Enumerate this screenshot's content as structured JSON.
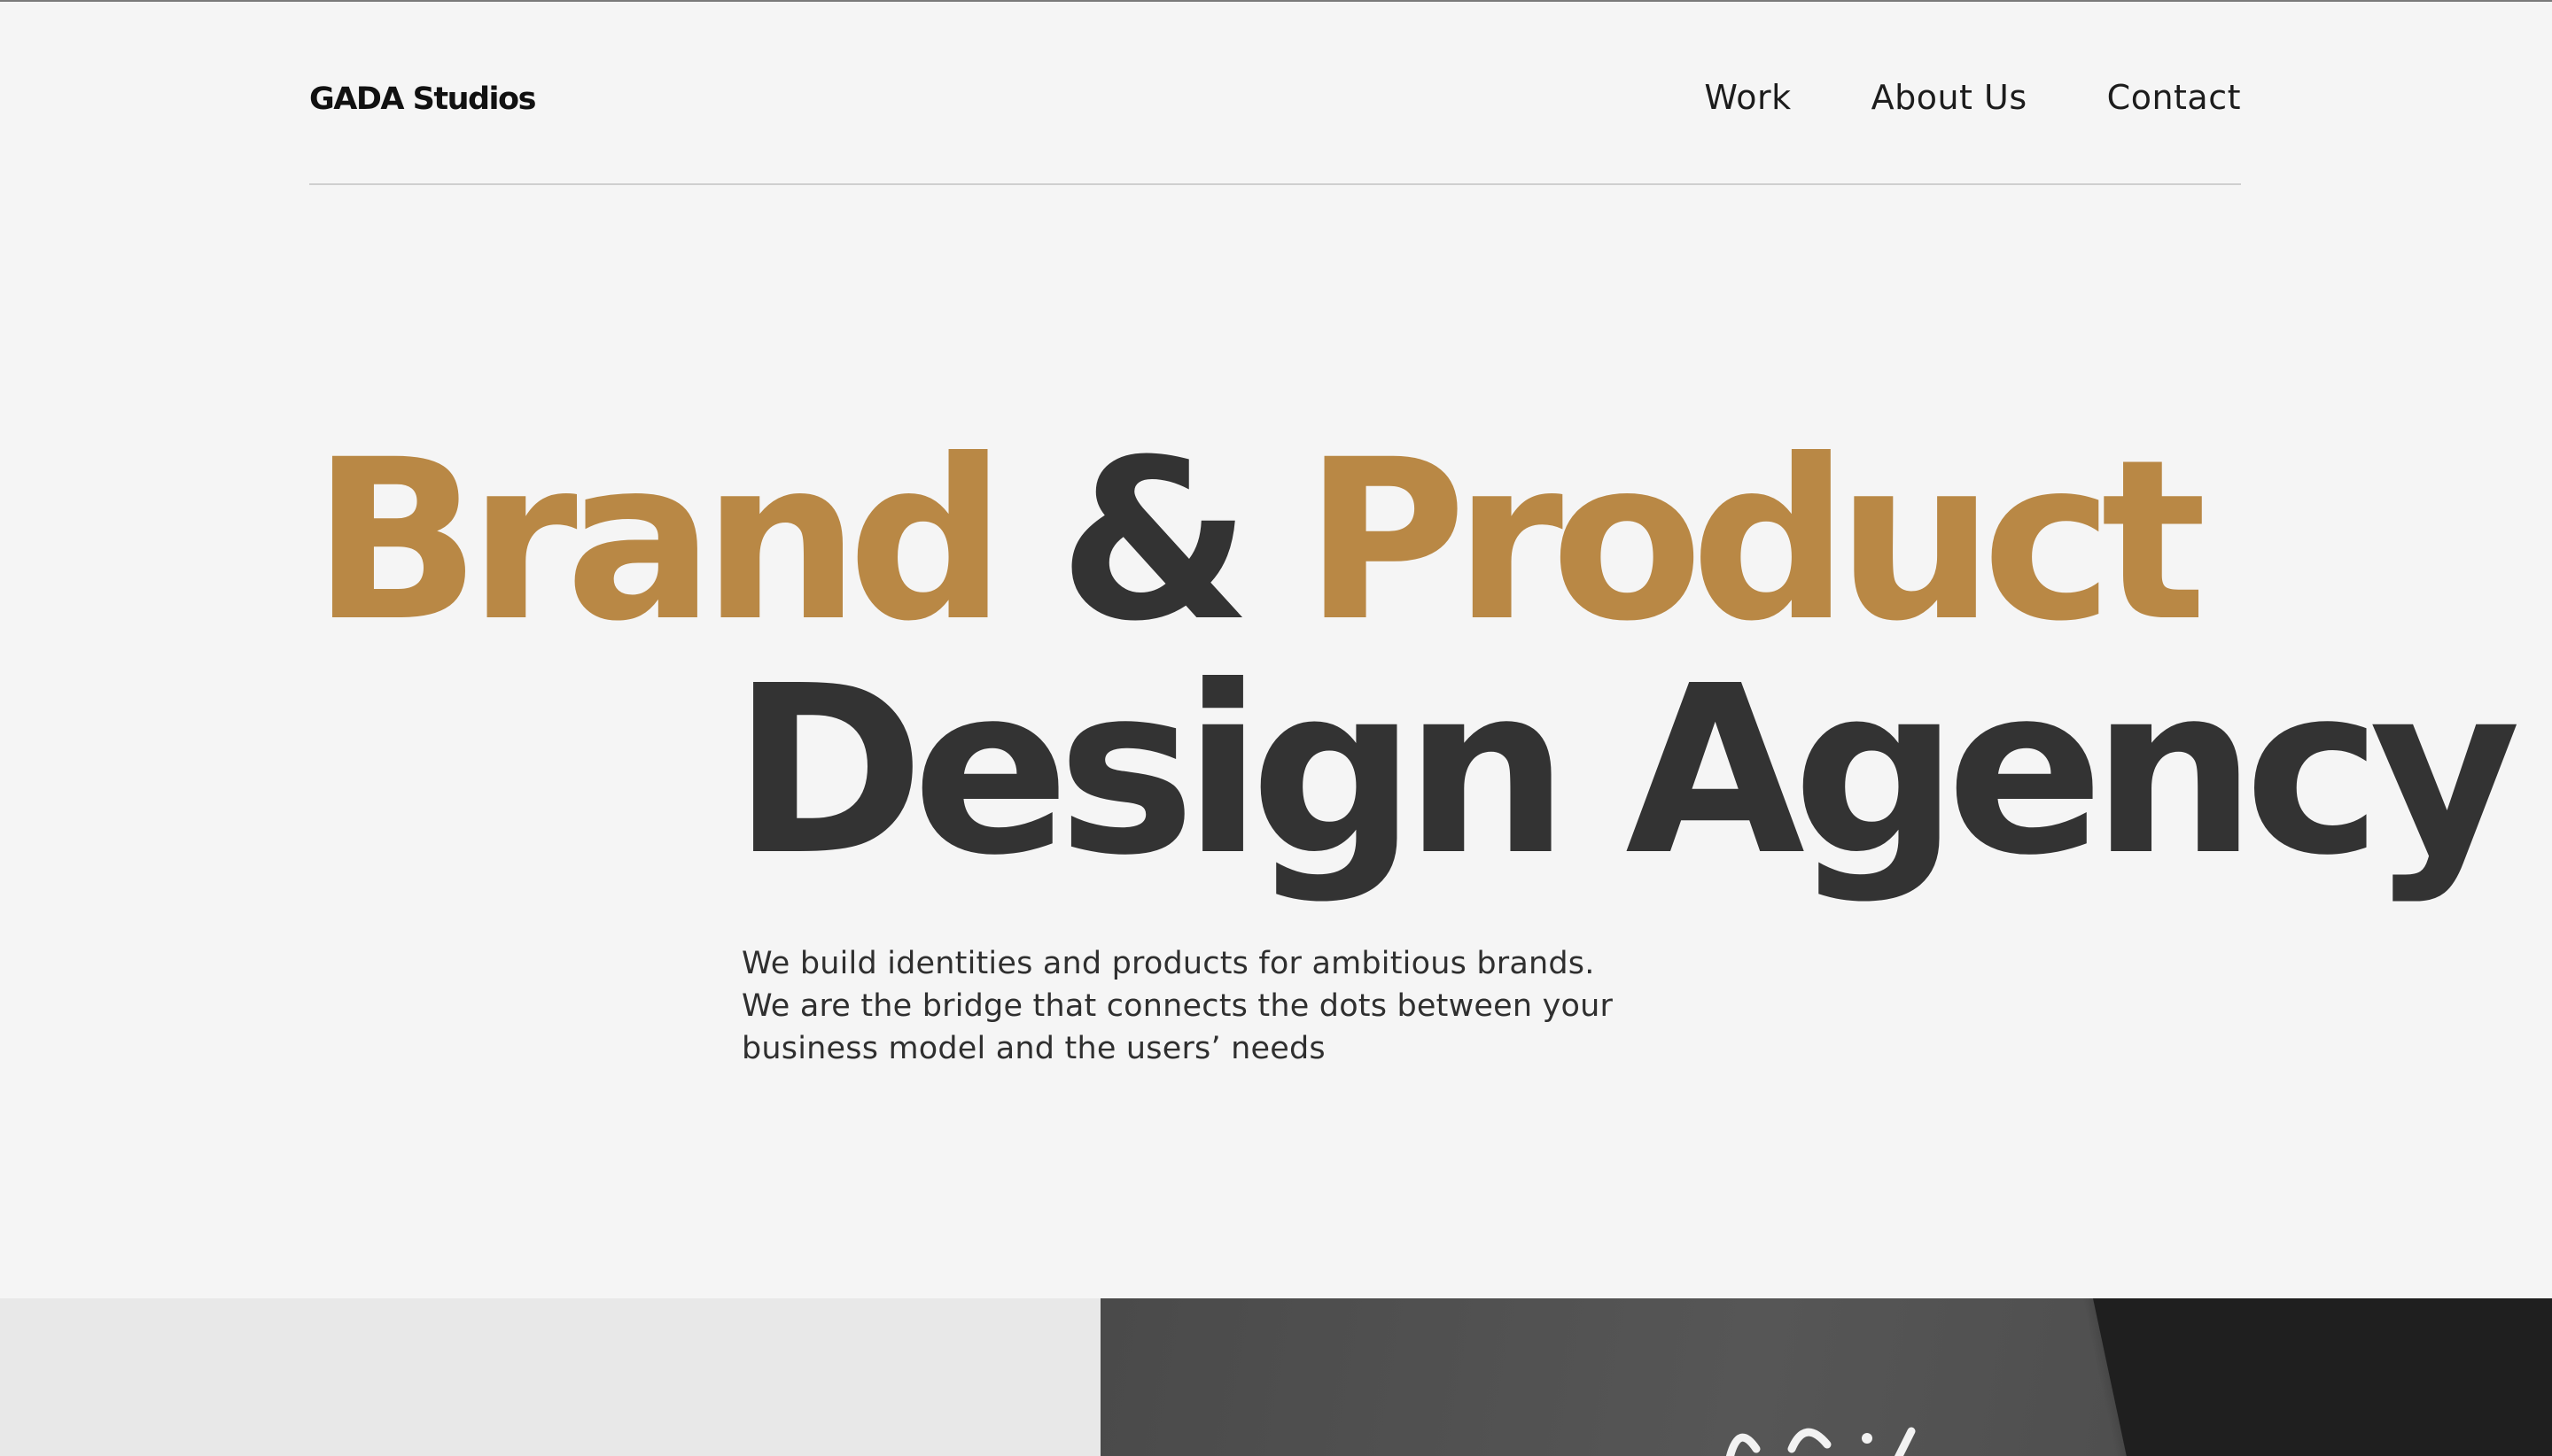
{
  "brand": {
    "name": "GADA Studios"
  },
  "nav": {
    "items": [
      {
        "label": "Work"
      },
      {
        "label": "About Us"
      },
      {
        "label": "Contact"
      }
    ]
  },
  "hero": {
    "line1": {
      "word1": "Brand",
      "amp": "&",
      "word2": "Product"
    },
    "line2": "Design Agency",
    "intro": [
      "We build identities and products for ambitious brands.",
      "We are the bridge that connects the dots between your",
      "business model and the users’ needs"
    ]
  },
  "colors": {
    "accent": "#b98845",
    "dark": "#333333",
    "background": "#f5f5f5"
  }
}
